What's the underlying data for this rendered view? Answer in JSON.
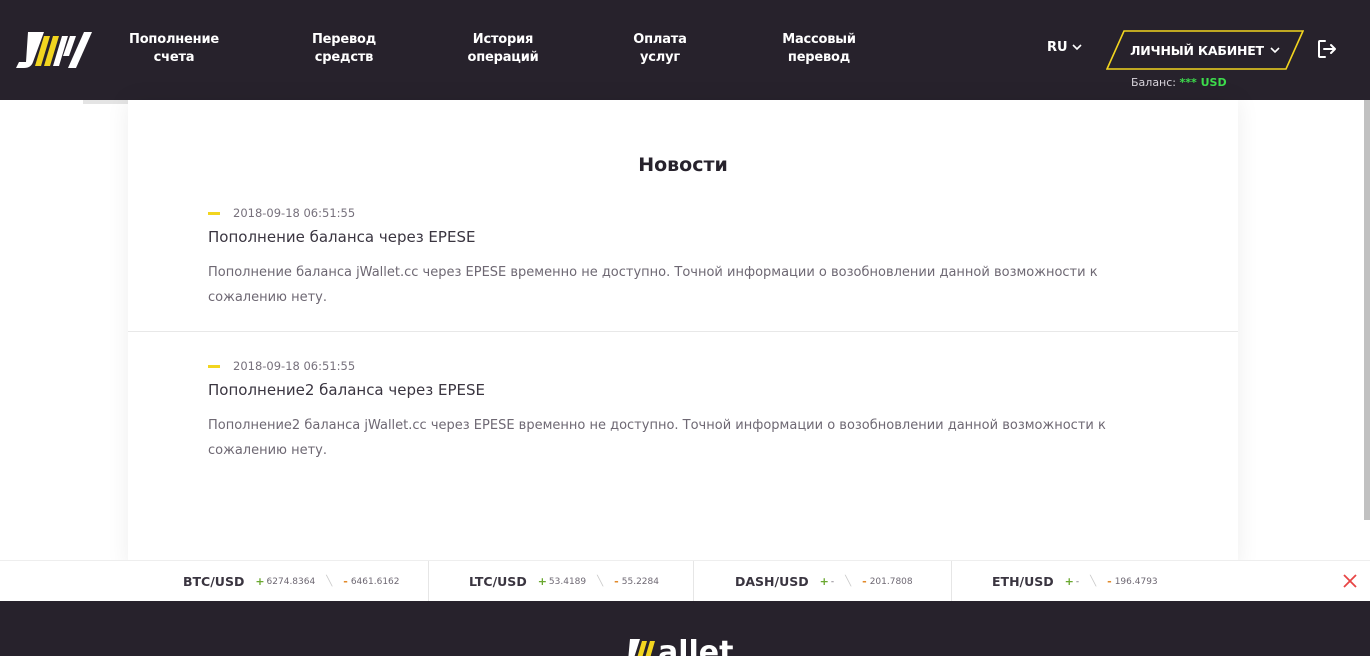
{
  "header": {
    "logo_icon": "jw-logo",
    "nav": [
      {
        "line1": "Пополнение",
        "line2": "счета"
      },
      {
        "line1": "Перевод",
        "line2": "средств"
      },
      {
        "line1": "История",
        "line2": "операций"
      },
      {
        "line1": "Оплата",
        "line2": "услуг"
      },
      {
        "line1": "Массовый",
        "line2": "перевод"
      }
    ],
    "lang": "RU",
    "cabinet_label": "ЛИЧНЫЙ КАБИНЕТ",
    "balance_label": "Баланс:",
    "balance_value": "*** USD"
  },
  "news": {
    "title": "Новости",
    "items": [
      {
        "date": "2018-09-18 06:51:55",
        "title": "Пополнение баланса через EPESE",
        "text": "Пополнение баланса jWallet.cc через EPESE временно не доступно. Точной информации о возобновлении данной возможности к сожалению нету."
      },
      {
        "date": "2018-09-18 06:51:55",
        "title": "Пополнение2 баланса через EPESE",
        "text": "Пополнение2 баланса jWallet.cc через EPESE временно не доступно. Точной информации о возобновлении данной возможности к сожалению нету."
      }
    ]
  },
  "ticker": [
    {
      "pair": "BTC/USD",
      "buy": "6274.8364",
      "sell": "6461.6162"
    },
    {
      "pair": "LTC/USD",
      "buy": "53.4189",
      "sell": "55.2284"
    },
    {
      "pair": "DASH/USD",
      "buy": "-",
      "sell": "201.7808"
    },
    {
      "pair": "ETH/USD",
      "buy": "-",
      "sell": "196.4793"
    }
  ],
  "footer": {
    "logo_text": "allet"
  },
  "colors": {
    "header_bg": "#27222c",
    "accent_yellow": "#f2d51f",
    "balance_green": "#3ddc4c",
    "close_red": "#e84545"
  }
}
